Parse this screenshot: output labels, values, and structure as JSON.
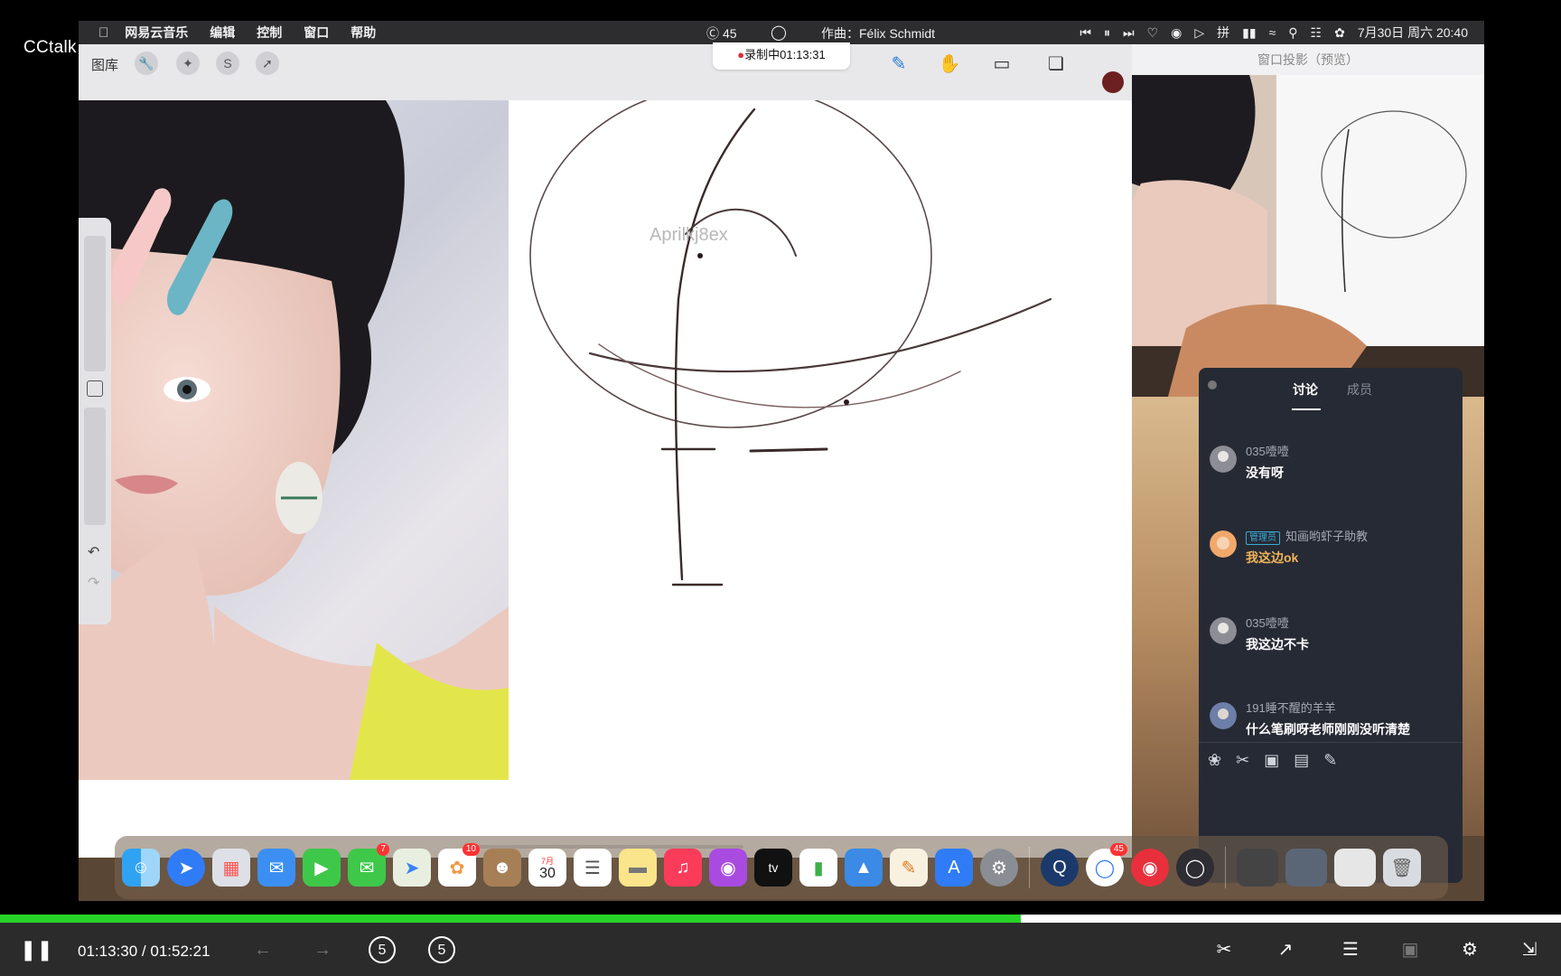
{
  "overlay": {
    "logo": "CCtalk"
  },
  "menubar": {
    "app_name": "网易云音乐",
    "items": [
      "编辑",
      "控制",
      "窗口",
      "帮助"
    ],
    "status_count": "45",
    "now_playing": "作曲：Félix Schmidt",
    "datetime": "7月30日 周六 20:40"
  },
  "procreate": {
    "gallery_label": "图库",
    "recording_label": "录制中01:13:31",
    "watermark": "Aprilkj8ex",
    "brush_color": "#6e1f1f"
  },
  "projection": {
    "title": "窗口投影（预览）"
  },
  "chat": {
    "tabs": {
      "discussion": "讨论",
      "members": "成员"
    },
    "messages": [
      {
        "user": "035噎噎",
        "text": "没有呀",
        "badge": ""
      },
      {
        "user": "知画哟虾子助教",
        "text": "我这边ok",
        "badge": "管理员"
      },
      {
        "user": "035噎噎",
        "text": "我这边不卡",
        "badge": ""
      },
      {
        "user": "191睡不醒的羊羊",
        "text": "什么笔刷呀老师刚刚没听清楚",
        "badge": ""
      }
    ]
  },
  "dock": {
    "badges": {
      "messages": "7",
      "photos": "10",
      "calendar_day": "30",
      "calendar_month": "7月",
      "chrome": "45"
    }
  },
  "player": {
    "current_time": "01:13:30",
    "separator": "/",
    "total_time": "01:52:21",
    "progress": 0.654,
    "skip_back": "5",
    "skip_forward": "5",
    "accent": "#29d329"
  }
}
